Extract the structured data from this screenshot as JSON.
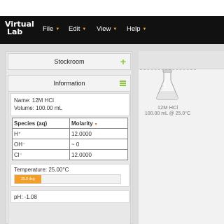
{
  "app": {
    "logo_line1": "Virtual",
    "logo_line2": "Lab"
  },
  "menu": [
    {
      "label": "File"
    },
    {
      "label": "Edit"
    },
    {
      "label": "View"
    },
    {
      "label": "Help"
    }
  ],
  "stockroom": {
    "title": "Stockroom",
    "icon": "plus-icon"
  },
  "information": {
    "title": "Information",
    "icon": "hamburger-icon",
    "name": "Name: 12M HCl",
    "volume": "Volume: 100.00 mL",
    "table": {
      "headers": [
        "Species (aq)",
        "Molarity"
      ],
      "rows": [
        [
          "H⁺",
          "12.0000"
        ],
        [
          "OH⁻",
          "~ 0"
        ],
        [
          "Cl⁻",
          "12.0000"
        ]
      ]
    },
    "temperature_label": "Temperature: 25.00°C",
    "temperature_bar_text": "25.0 deg",
    "temperature_fraction": 0.25,
    "ph": "pH: -1.08"
  },
  "workbench": {
    "flask_name": "12M HCl",
    "flask_detail": "100.00 mL @ 25.0°C"
  },
  "colors": {
    "accent": "#8cc63e",
    "orange": "#f0a028",
    "topbar": "#111111"
  }
}
